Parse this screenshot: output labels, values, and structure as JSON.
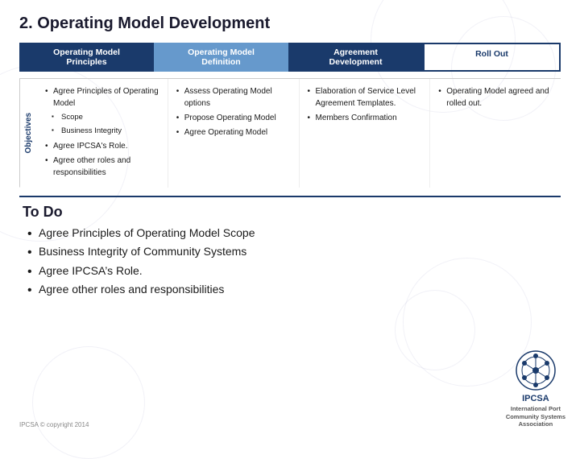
{
  "page": {
    "title": "2. Operating Model Development",
    "footer": "IPCSA © copyright 2014"
  },
  "phases": [
    {
      "id": "principles",
      "label": "Operating Model\nPrinciples",
      "style": "active"
    },
    {
      "id": "definition",
      "label": "Operating Model\nDefinition",
      "style": "light"
    },
    {
      "id": "agreement",
      "label": "Agreement\nDevelopment",
      "style": "active"
    },
    {
      "id": "rollout",
      "label": "Roll Out",
      "style": "outline"
    }
  ],
  "objectives_label": "Objectives",
  "columns": [
    {
      "id": "col-principles",
      "items": [
        "Agree Principles of Operating Model",
        "sub:Scope",
        "sub:Business Integrity",
        "Agree IPCSA's Role.",
        "Agree other roles and responsibilities"
      ]
    },
    {
      "id": "col-definition",
      "items": [
        "Assess Operating Model options",
        "Propose Operating Model",
        "Agree Operating Model"
      ]
    },
    {
      "id": "col-agreement",
      "items": [
        "Elaboration of Service Level Agreement Templates.",
        "Members Confirmation"
      ]
    },
    {
      "id": "col-rollout",
      "items": [
        "Operating Model agreed and rolled out."
      ]
    }
  ],
  "todo": {
    "title": "To Do",
    "items": [
      "Agree Principles of Operating Model Scope",
      "Business Integrity of Community Systems",
      "Agree IPCSA’s Role.",
      "Agree other roles and responsibilities"
    ]
  },
  "logo": {
    "name": "IPCSA",
    "lines": [
      "International Port",
      "Community Systems",
      "Association"
    ]
  },
  "colors": {
    "dark_blue": "#1a3a6b",
    "mid_blue": "#6699cc",
    "text_dark": "#1a1a1a",
    "divider": "#1a3a6b"
  }
}
